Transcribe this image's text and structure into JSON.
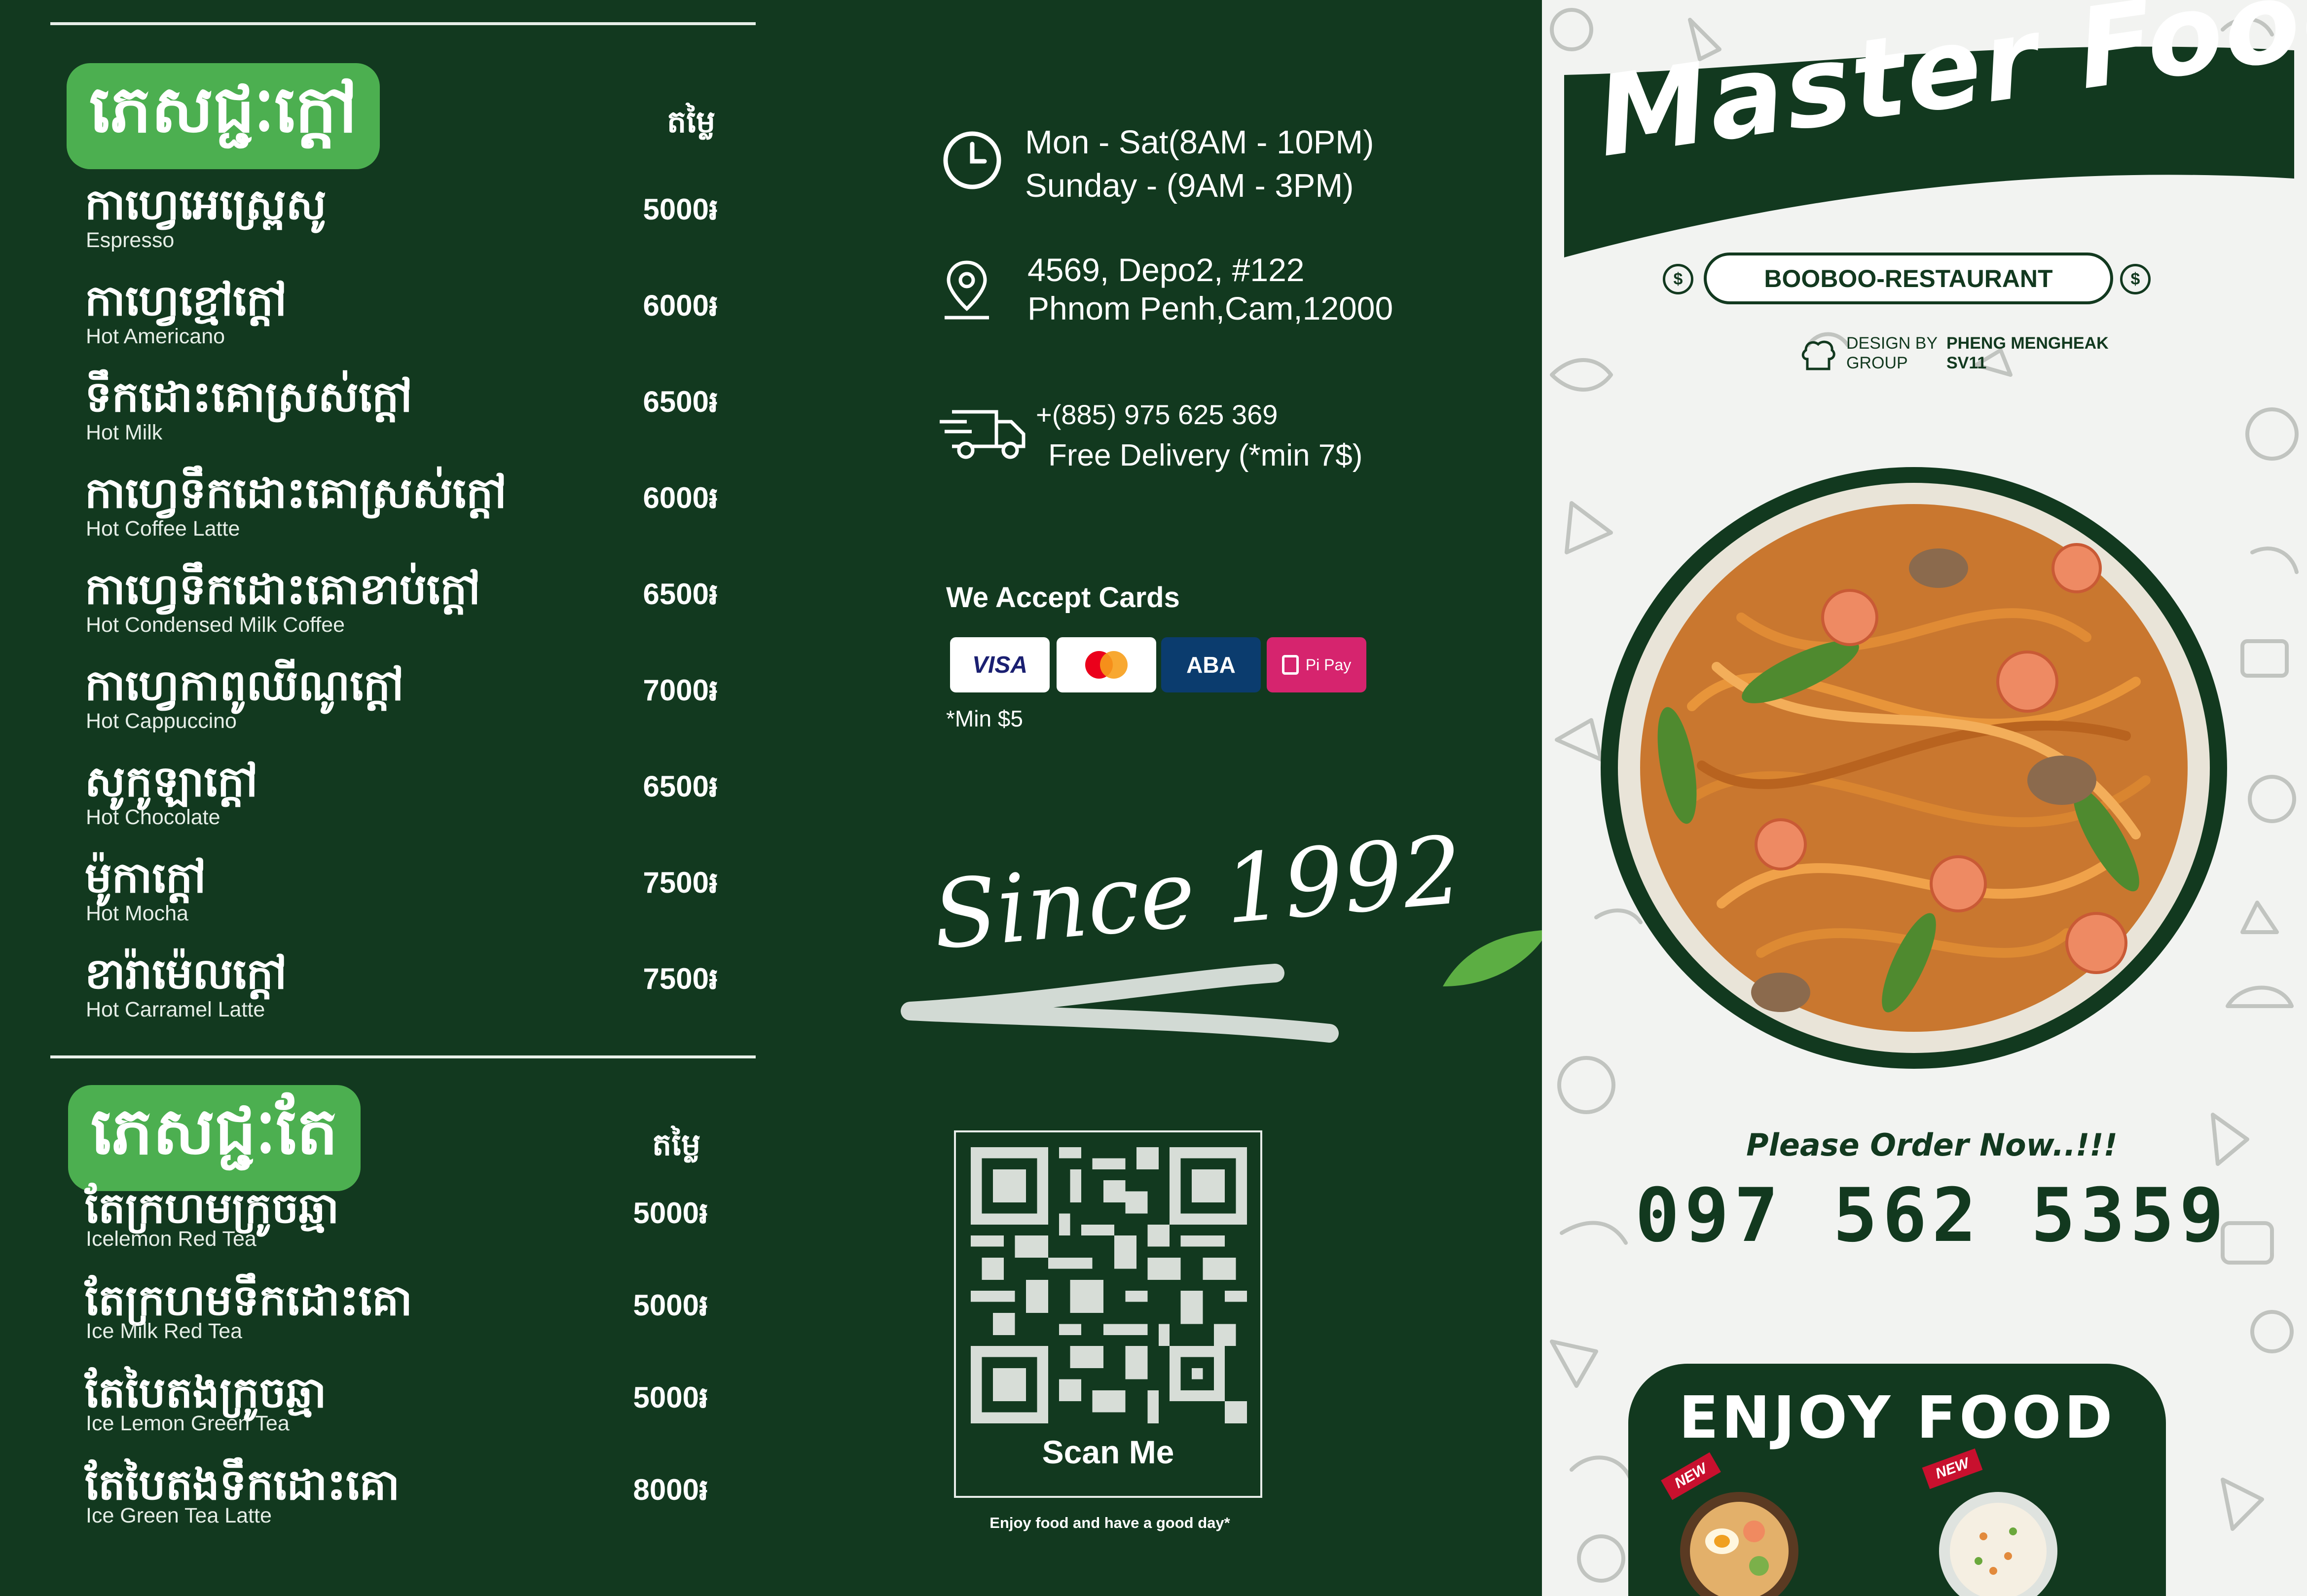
{
  "menu_hot": {
    "category_kh": "ភេសជ្ជៈក្ដៅ",
    "price_header": "តម្លៃ",
    "items": [
      {
        "kh": "កាហ្វេអេស្ព្រេសូ",
        "en": "Espresso",
        "price": "5000៛"
      },
      {
        "kh": "កាហ្វេខ្មៅក្ដៅ",
        "en": "Hot Americano",
        "price": "6000៛"
      },
      {
        "kh": "ទឹកដោះគោស្រស់ក្ដៅ",
        "en": "Hot Milk",
        "price": "6500៛"
      },
      {
        "kh": "កាហ្វេទឹកដោះគោស្រស់ក្ដៅ",
        "en": "Hot Coffee Latte",
        "price": "6000៛"
      },
      {
        "kh": "កាហ្វេទឹកដោះគោខាប់ក្ដៅ",
        "en": "Hot Condensed Milk Coffee",
        "price": "6500៛"
      },
      {
        "kh": "កាហ្វេកាពូឈីណូក្ដៅ",
        "en": "Hot Cappuccino",
        "price": "7000៛"
      },
      {
        "kh": "សូកូឡាក្ដៅ",
        "en": "Hot Chocolate",
        "price": "6500៛"
      },
      {
        "kh": "ម៉ូកាក្ដៅ",
        "en": "Hot Mocha",
        "price": "7500៛"
      },
      {
        "kh": "ខារ៉ាម៉េលក្ដៅ",
        "en": "Hot Carramel Latte",
        "price": "7500៛"
      }
    ]
  },
  "menu_tea": {
    "category_kh": "ភេសជ្ជៈតែ",
    "price_header": "តម្លៃ",
    "items": [
      {
        "kh": "តែក្រហមក្រូចឆ្មា",
        "en": "Icelemon Red Tea",
        "price": "5000៛"
      },
      {
        "kh": "តែក្រហមទឹកដោះគោ",
        "en": "Ice Milk Red Tea",
        "price": "5000៛"
      },
      {
        "kh": "តែបៃតងក្រូចឆ្មា",
        "en": "Ice Lemon Green Tea",
        "price": "5000៛"
      },
      {
        "kh": "តែបៃតងទឹកដោះគោ",
        "en": "Ice Green Tea Latte",
        "price": "8000៛"
      }
    ]
  },
  "info": {
    "hours_line1": "Mon - Sat(8AM - 10PM)",
    "hours_line2": "Sunday - (9AM - 3PM)",
    "address_line1": "4569, Depo2, #122",
    "address_line2": "Phnom Penh,Cam,12000",
    "phone": "+(885) 975 625 369",
    "delivery": "Free Delivery (*min 7$)",
    "cards_heading": "We Accept Cards",
    "cards": [
      "VISA",
      "",
      "ABA",
      "Pi Pay"
    ],
    "cards_note": "*Min $5",
    "since": "Since 1992",
    "scan_label": "Scan Me",
    "enjoy_note": "Enjoy food and have a good day*"
  },
  "cover": {
    "title": "Master Food",
    "restaurant": "BOOBOO-RESTAURANT",
    "coin_symbol": "$",
    "design_by_label": "DESIGN BY",
    "design_group_label": "GROUP",
    "designer_name": "PHENG MENGHEAK",
    "designer_group": "SV11",
    "please_order": "Please Order Now..!!!",
    "order_phone": "097 562 5359",
    "enjoy_title": "ENJOY FOOD",
    "badge_new": "NEW"
  },
  "colors": {
    "dark_green": "#12391f",
    "accent_green": "#4caf50",
    "visa_blue": "#1a1f71",
    "aba_navy": "#0b3c6e",
    "pipay_pink": "#d6246e"
  }
}
